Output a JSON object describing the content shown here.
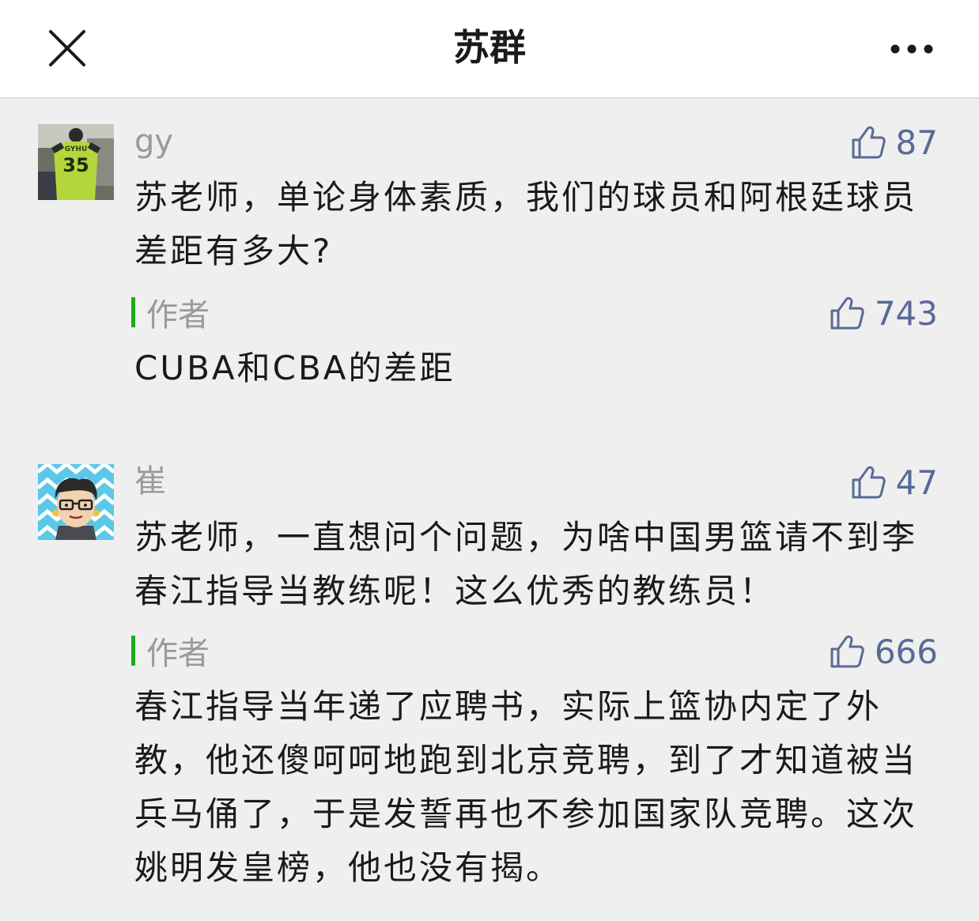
{
  "header": {
    "title": "苏群",
    "close_icon": "close-icon",
    "more_icon": "more-dots-icon"
  },
  "comments": [
    {
      "nickname": "gy",
      "likes": "87",
      "text": "苏老师，单论身体素质，我们的球员和阿根廷球员差距有多大?",
      "avatar_jersey_name": "GYHU",
      "avatar_jersey_number": "35",
      "reply": {
        "label": "作者",
        "likes": "743",
        "text": "CUBA和CBA的差距"
      }
    },
    {
      "nickname": "崔",
      "likes": "47",
      "text": "苏老师，一直想问个问题，为啥中国男篮请不到李春江指导当教练呢！这么优秀的教练员！",
      "reply": {
        "label": "作者",
        "likes": "666",
        "text": "春江指导当年递了应聘书，实际上篮协内定了外教，他还傻呵呵地跑到北京竞聘，到了才知道被当兵马俑了，于是发誓再也不参加国家队竞聘。这次姚明发皇榜，他也没有揭。"
      }
    }
  ],
  "colors": {
    "link_blue": "#576b95",
    "author_bar_green": "#1aad19",
    "nickname_gray": "#9a9a9a",
    "background": "#efefef"
  }
}
